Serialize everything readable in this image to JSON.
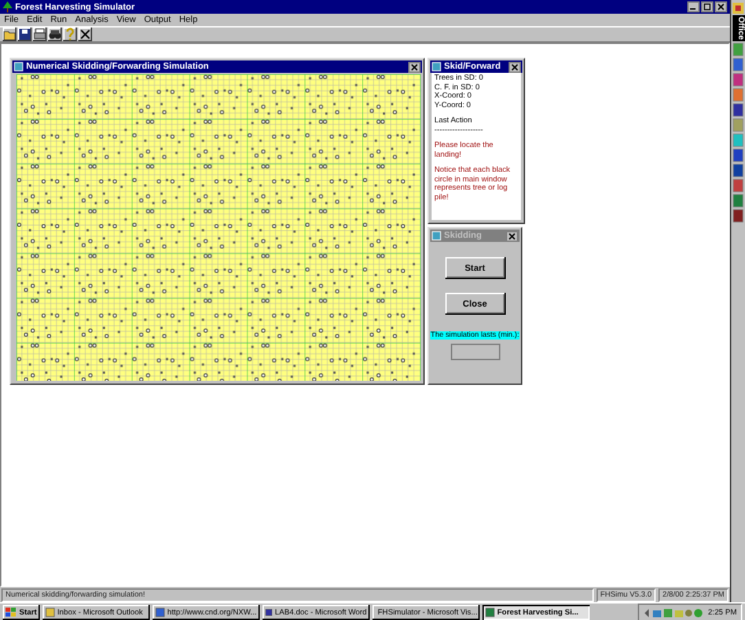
{
  "window": {
    "title": "Forest Harvesting Simulator"
  },
  "menu": [
    {
      "label": "File"
    },
    {
      "label": "Edit"
    },
    {
      "label": "Run"
    },
    {
      "label": "Analysis"
    },
    {
      "label": "View"
    },
    {
      "label": "Output"
    },
    {
      "label": "Help"
    }
  ],
  "toolbar": [
    {
      "kind": "open"
    },
    {
      "kind": "save"
    },
    {
      "kind": "print"
    },
    {
      "kind": "find"
    },
    {
      "kind": "help"
    },
    {
      "kind": "close"
    }
  ],
  "simulation_window": {
    "title": "Numerical Skidding/Forwarding Simulation"
  },
  "skid_forward_panel": {
    "title": "Skid/Forward",
    "lines": [
      {
        "kind": "info",
        "text": "Trees in SD: 0"
      },
      {
        "kind": "info",
        "text": "C. F. in SD: 0"
      },
      {
        "kind": "info",
        "text": "X-Coord: 0"
      },
      {
        "kind": "info",
        "text": "Y-Coord: 0"
      },
      {
        "kind": "gap"
      },
      {
        "kind": "info",
        "text": "Last Action"
      },
      {
        "kind": "info",
        "text": "-------------------"
      },
      {
        "kind": "gap"
      },
      {
        "kind": "message",
        "text": "Please locate the landing!"
      },
      {
        "kind": "gap"
      },
      {
        "kind": "message",
        "text": "Notice that each black circle in main window represents tree or log pile!"
      }
    ]
  },
  "skidding_panel": {
    "title": "Skidding",
    "buttons": [
      {
        "label": "Start"
      },
      {
        "label": "Close"
      }
    ],
    "duration_label": "The simulation lasts (min.):"
  },
  "status_bar": [
    "Numerical skidding/forwarding simulation!",
    "FHSimu V5.3.0",
    "2/8/00 2:25:37 PM"
  ],
  "office_bar": {
    "label": "Office"
  },
  "taskbar": {
    "start": "Start",
    "tasks": [
      {
        "label": "Inbox - Microsoft Outlook",
        "selected": false
      },
      {
        "label": "http://www.cnd.org/NXW...",
        "selected": false
      },
      {
        "label": "LAB4.doc - Microsoft Word",
        "selected": false
      },
      {
        "label": "FHSimulator - Microsoft Vis...",
        "selected": false
      },
      {
        "label": "Forest Harvesting Si...",
        "selected": true
      }
    ],
    "clock": "2:25 PM"
  }
}
